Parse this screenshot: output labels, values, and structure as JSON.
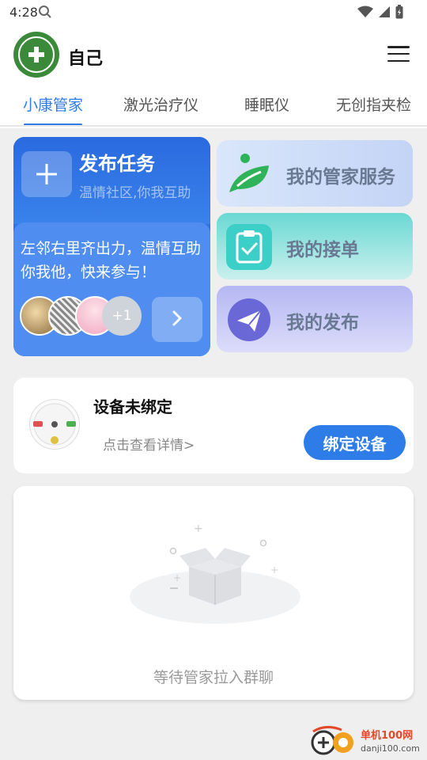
{
  "status_bar": {
    "time": "4:28"
  },
  "header": {
    "user_name": "自己"
  },
  "tabs": [
    {
      "label": "小康管家"
    },
    {
      "label": "激光治疗仪"
    },
    {
      "label": "睡眠仪"
    },
    {
      "label": "无创指夹检"
    }
  ],
  "task_card": {
    "title": "发布任务",
    "subtitle": "温情社区,你我互助",
    "description": "左邻右里齐出力，温情互助你我他，快来参与！",
    "participant_extra": "+1"
  },
  "services": [
    {
      "label": "我的管家服务",
      "icon": "leaf-icon"
    },
    {
      "label": "我的接单",
      "icon": "clipboard-check-icon"
    },
    {
      "label": "我的发布",
      "icon": "paper-plane-icon"
    }
  ],
  "device": {
    "title": "设备未绑定",
    "detail_link": "点击查看详情>",
    "bind_button": "绑定设备"
  },
  "empty_state": {
    "text": "等待管家拉入群聊"
  },
  "watermark": {
    "name": "单机100网",
    "url": "danji100.com"
  },
  "colors": {
    "accent": "#2d7ce8",
    "task_blue": "#2f74e6"
  }
}
